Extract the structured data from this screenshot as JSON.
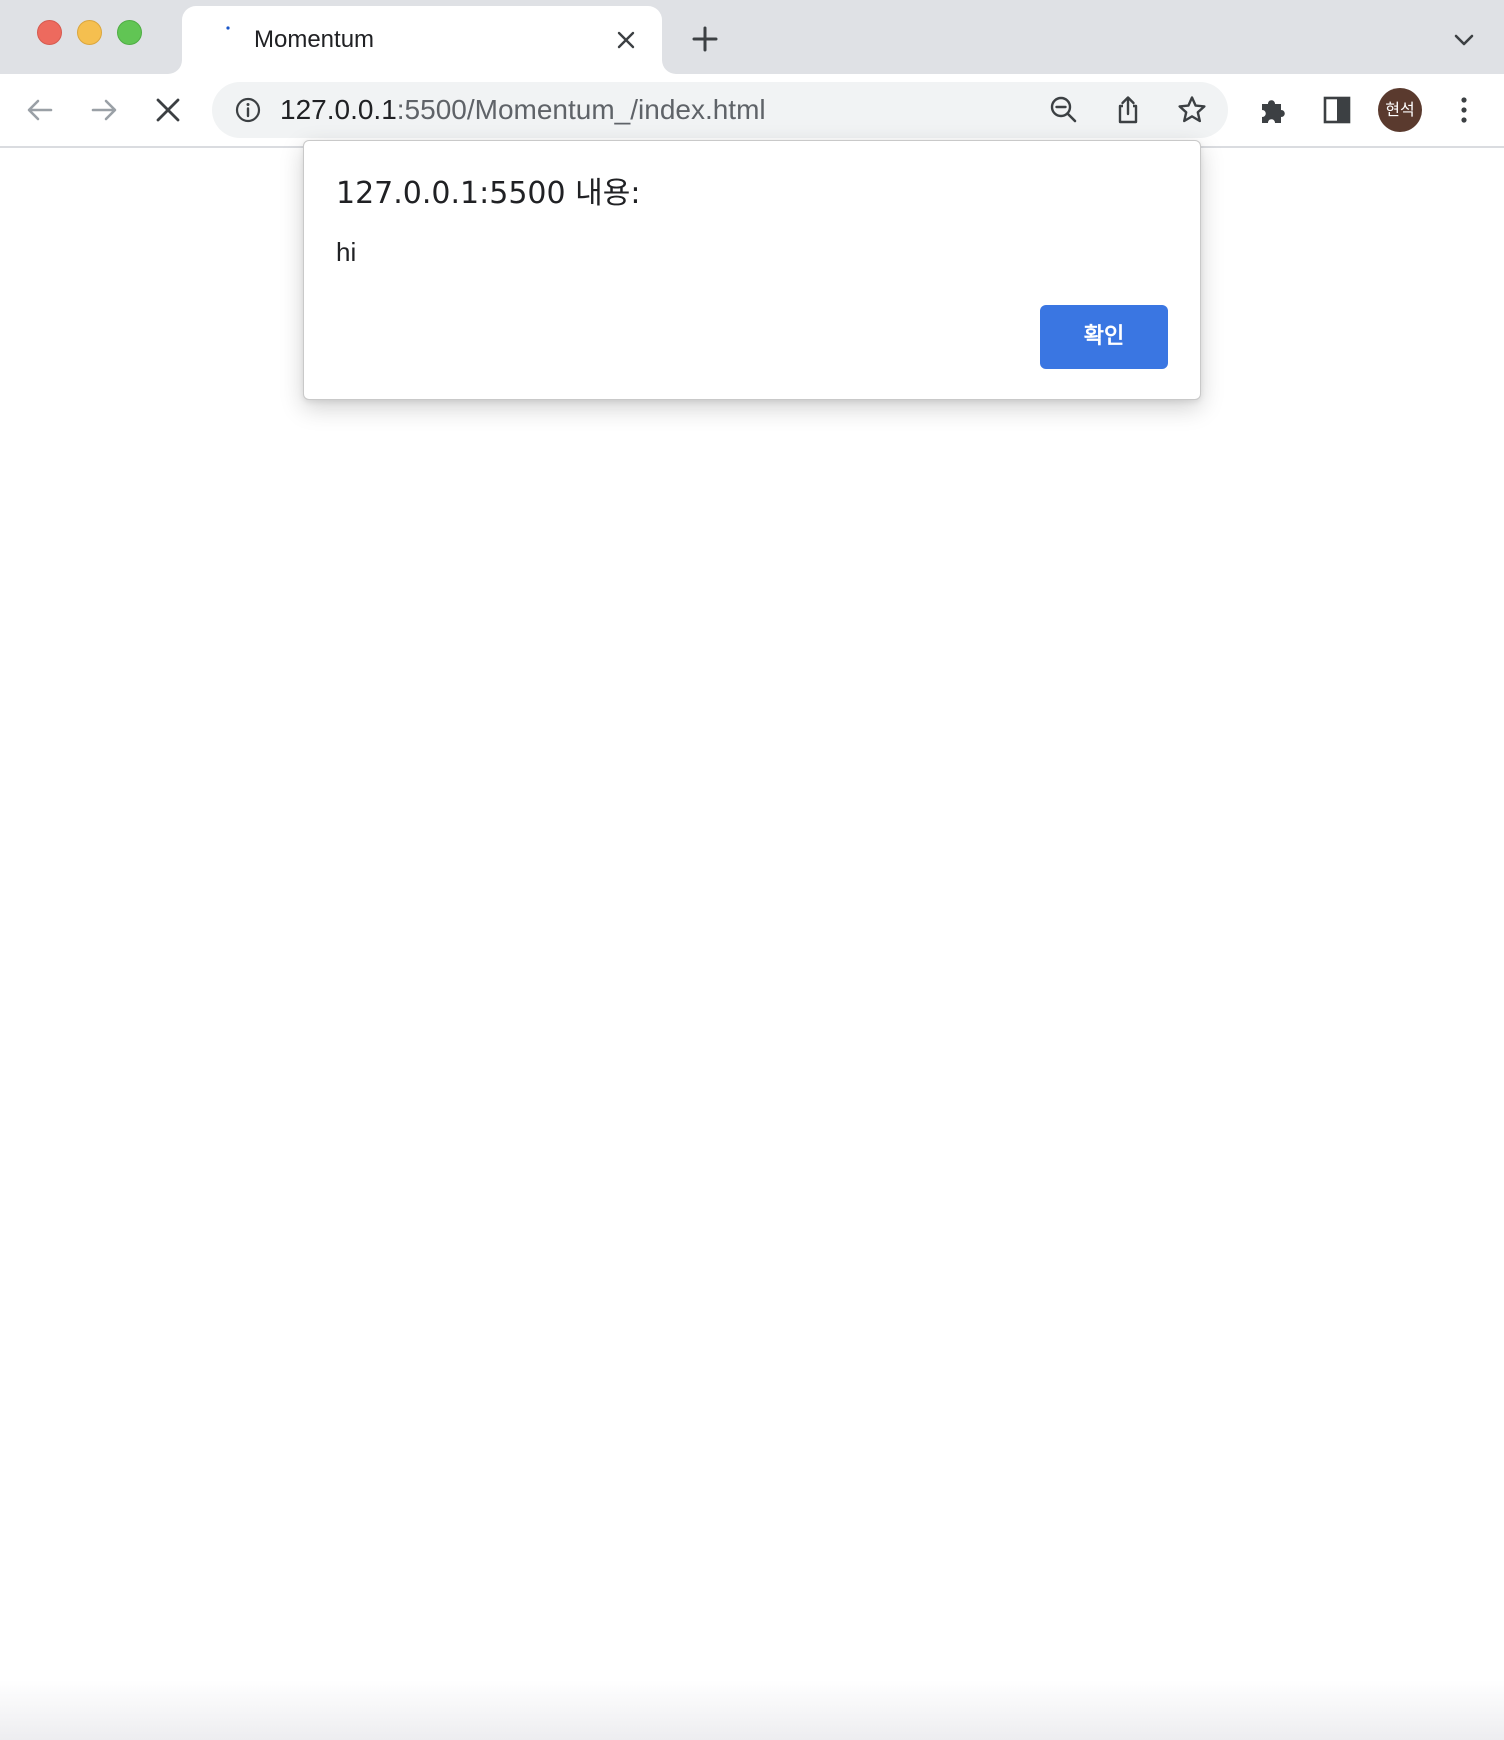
{
  "window": {
    "controls": [
      "close",
      "minimize",
      "zoom"
    ]
  },
  "tab": {
    "title": "Momentum",
    "loading": true,
    "close_icon": "close-icon",
    "new_tab_icon": "plus-icon",
    "tab_search_icon": "chevron-down-icon"
  },
  "toolbar": {
    "back_icon": "arrow-left-icon",
    "forward_icon": "arrow-right-icon",
    "stop_icon": "close-icon",
    "omnibox": {
      "info_icon": "info-icon",
      "url_host": "127.0.0.1",
      "url_rest": ":5500/Momentum_/index.html",
      "actions": [
        "zoom-out-icon",
        "share-icon",
        "star-icon"
      ]
    },
    "extensions_icon": "puzzle-icon",
    "side_panel_icon": "side-panel-icon",
    "profile": {
      "initials": "현석",
      "color": "#5a3a2e"
    },
    "menu_icon": "kebab-menu-icon"
  },
  "dialog": {
    "title": "127.0.0.1:5500 내용:",
    "message": "hi",
    "ok_label": "확인",
    "ok_color": "#3a76e2"
  },
  "colors": {
    "tabstrip": "#dfe1e5",
    "omnibox": "#f1f3f4",
    "close_red": "#ed6a5e",
    "minimize_yellow": "#f5bf4f",
    "zoom_green": "#61c554"
  }
}
